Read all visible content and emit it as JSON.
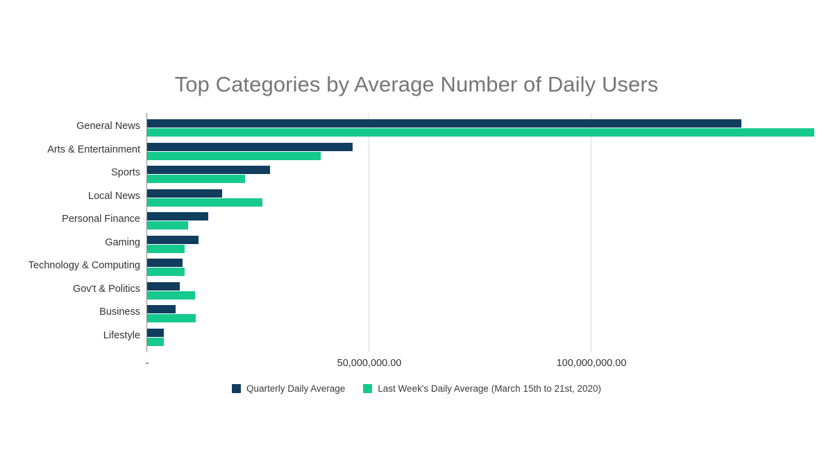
{
  "chart_data": {
    "type": "bar",
    "orientation": "horizontal",
    "title": "Top Categories by Average Number of Daily Users",
    "xlabel": "",
    "ylabel": "",
    "categories": [
      "General News",
      "Arts & Entertainment",
      "Sports",
      "Local News",
      "Personal Finance",
      "Gaming",
      "Technology & Computing",
      "Gov't & Politics",
      "Business",
      "Lifestyle"
    ],
    "series": [
      {
        "name": "Quarterly Daily Average",
        "color": "#113d5e",
        "values": [
          133700000,
          46300000,
          27600000,
          16800000,
          13700000,
          11500000,
          8000000,
          7300000,
          6400000,
          3700000
        ]
      },
      {
        "name": "Last Week's Daily Average (March 15th to 21st, 2020)",
        "color": "#16c98d",
        "values": [
          150200000,
          39000000,
          22100000,
          26000000,
          9200000,
          8400000,
          8400000,
          10800000,
          11000000,
          3700000
        ]
      }
    ],
    "xlim": [
      0,
      154000000
    ],
    "xticks": [
      {
        "value": 0,
        "label": "-"
      },
      {
        "value": 50000000,
        "label": "50,000,000.00"
      },
      {
        "value": 100000000,
        "label": "100,000,000.00"
      }
    ],
    "gridlines": [
      50000000,
      100000000
    ],
    "grid": true,
    "legend_position": "bottom",
    "axis_color": "#8c8c8c",
    "grid_color": "#d9d9d9",
    "title_color": "#767676",
    "label_color": "#333333"
  }
}
